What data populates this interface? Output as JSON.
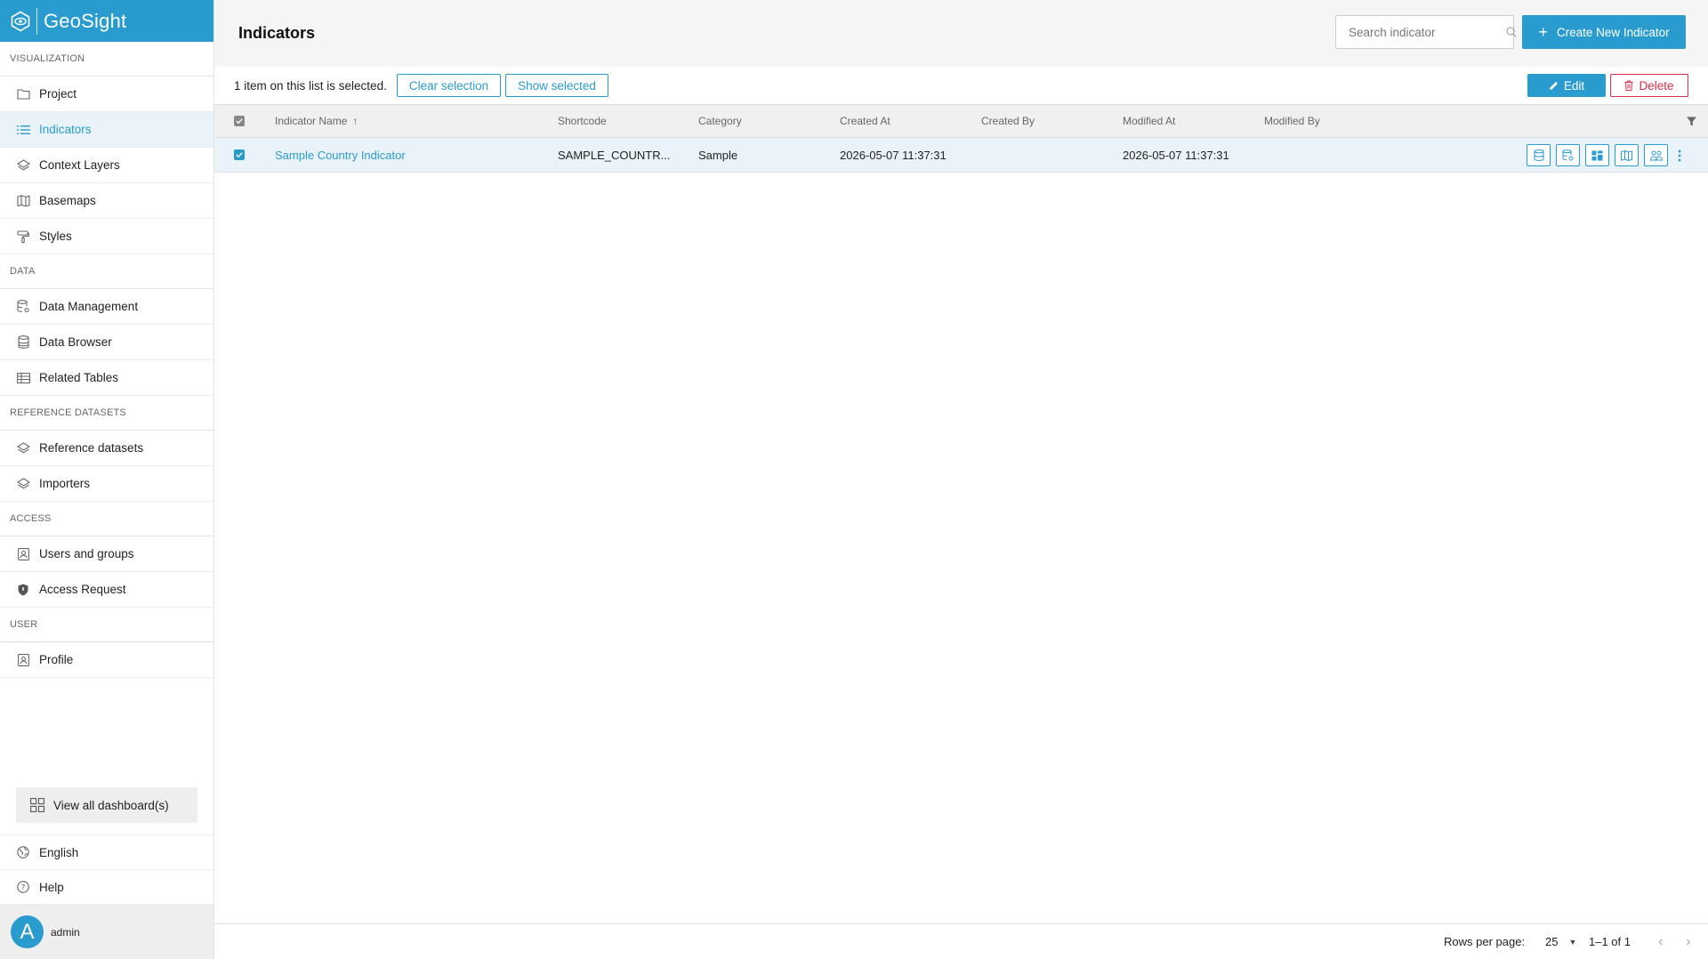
{
  "brand": {
    "name": "GeoSight"
  },
  "sidebar": {
    "sections": [
      {
        "title": "VISUALIZATION",
        "items": [
          {
            "label": "Project",
            "icon": "folder-icon"
          },
          {
            "label": "Indicators",
            "icon": "list-icon",
            "active": true
          },
          {
            "label": "Context Layers",
            "icon": "layers-icon"
          },
          {
            "label": "Basemaps",
            "icon": "map-icon"
          },
          {
            "label": "Styles",
            "icon": "paint-roller-icon"
          }
        ]
      },
      {
        "title": "DATA",
        "items": [
          {
            "label": "Data Management",
            "icon": "database-gear-icon"
          },
          {
            "label": "Data Browser",
            "icon": "database-icon"
          },
          {
            "label": "Related Tables",
            "icon": "table-icon"
          }
        ]
      },
      {
        "title": "REFERENCE DATASETS",
        "items": [
          {
            "label": "Reference datasets",
            "icon": "layers-icon"
          },
          {
            "label": "Importers",
            "icon": "layers-icon"
          }
        ]
      },
      {
        "title": "ACCESS",
        "items": [
          {
            "label": "Users and groups",
            "icon": "user-card-icon"
          },
          {
            "label": "Access Request",
            "icon": "shield-icon"
          }
        ]
      },
      {
        "title": "USER",
        "items": [
          {
            "label": "Profile",
            "icon": "user-card-icon"
          }
        ]
      }
    ],
    "view_all": "View all dashboard(s)",
    "language": "English",
    "help": "Help",
    "user": {
      "initial": "A",
      "name": "admin"
    }
  },
  "header": {
    "title": "Indicators",
    "search_placeholder": "Search indicator",
    "create_label": "Create New Indicator"
  },
  "selection": {
    "text": "1 item on this list is selected.",
    "clear_label": "Clear selection",
    "show_label": "Show selected",
    "edit_label": "Edit",
    "delete_label": "Delete"
  },
  "table": {
    "columns": [
      "Indicator Name",
      "Shortcode",
      "Category",
      "Created At",
      "Created By",
      "Modified At",
      "Modified By"
    ],
    "rows": [
      {
        "name": "Sample Country Indicator",
        "shortcode": "SAMPLE_COUNTR...",
        "category": "Sample",
        "created_at": "2026-05-07 11:37:31",
        "created_by": "",
        "modified_at": "2026-05-07 11:37:31",
        "modified_by": "",
        "selected": true
      }
    ]
  },
  "footer": {
    "rows_per_page_label": "Rows per page:",
    "rows_per_page": "25",
    "range": "1–1 of 1"
  },
  "colors": {
    "accent": "#2a9bcf",
    "danger": "#d9304a"
  }
}
